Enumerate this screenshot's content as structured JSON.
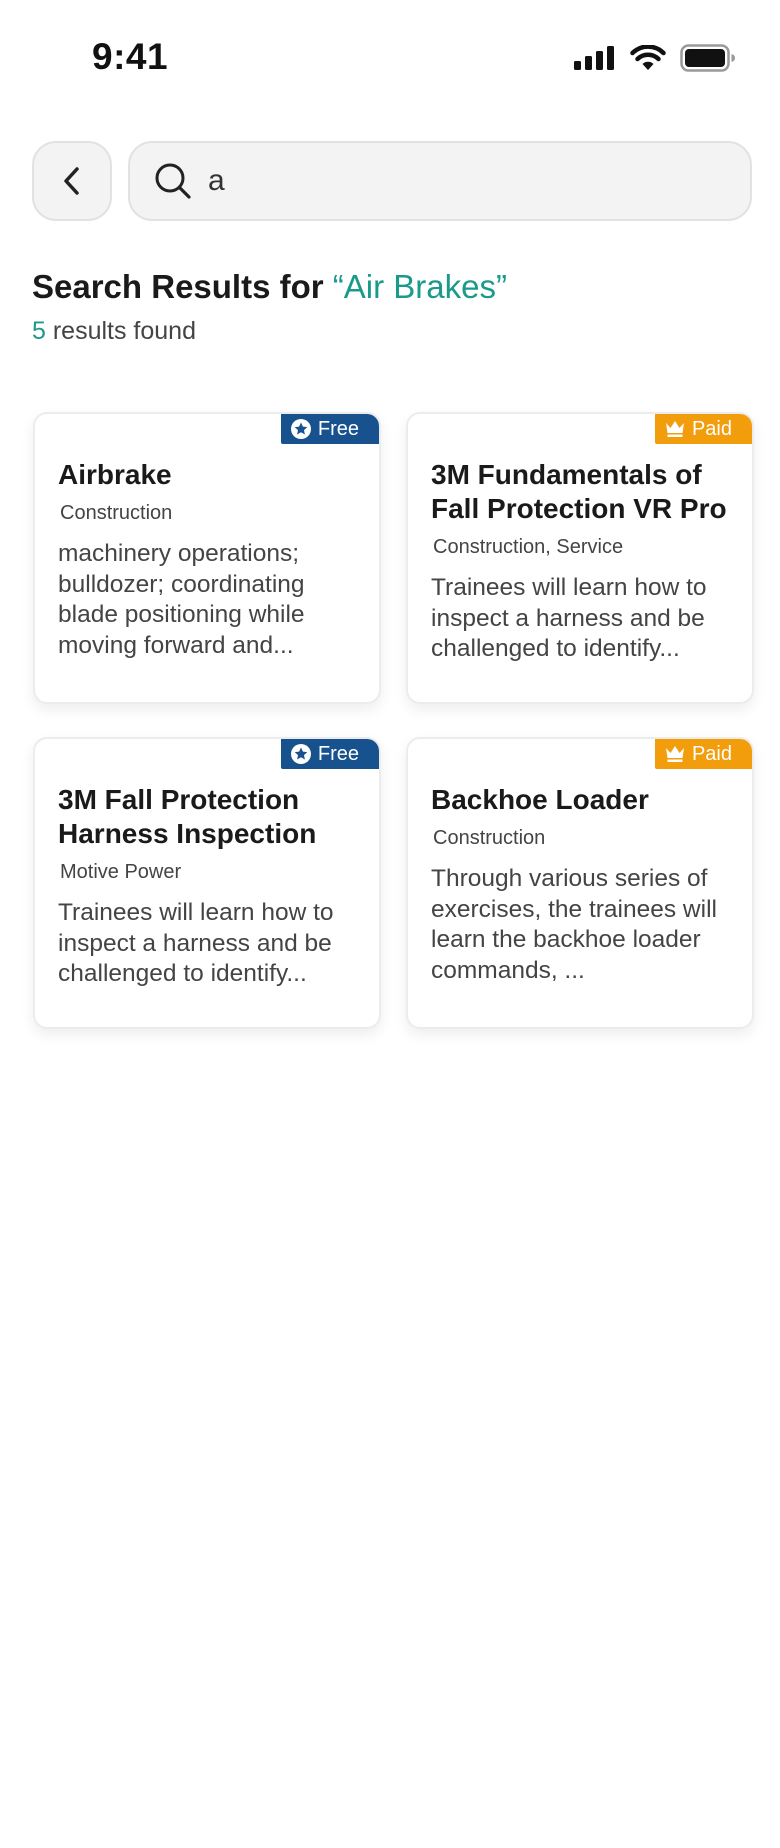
{
  "status_bar": {
    "time": "9:41"
  },
  "search": {
    "value": "a",
    "back_icon": "chevron-left-icon",
    "search_icon": "search-icon"
  },
  "results": {
    "title_prefix": "Search Results for ",
    "query": "“Air Brakes”",
    "count": "5",
    "count_suffix": " results found"
  },
  "cards": [
    {
      "badge": "Free",
      "badge_type": "free",
      "badge_color": "#17528f",
      "title": "Airbrake",
      "category": "Construction",
      "description": "machinery operations; bulldozer; coordinating blade positioning while moving forward and..."
    },
    {
      "badge": "Paid",
      "badge_type": "paid",
      "badge_color": "#f29d0c",
      "title": "3M Fundamentals of Fall Protection VR Pro",
      "category": "Construction, Service",
      "description": "Trainees will learn how to inspect a harness and be challenged to identify..."
    },
    {
      "badge": "Free",
      "badge_type": "free",
      "badge_color": "#17528f",
      "title": "3M Fall Protection Harness Inspection",
      "category": "Motive Power",
      "description": "Trainees will learn how to inspect a harness and be challenged to identify..."
    },
    {
      "badge": "Paid",
      "badge_type": "paid",
      "badge_color": "#f29d0c",
      "title": "Backhoe Loader",
      "category": "Construction",
      "description": "Through various series of exercises, the trainees will learn the backhoe loader commands, ..."
    }
  ],
  "colors": {
    "accent": "#1a9a8a",
    "free": "#17528f",
    "paid": "#f29d0c"
  }
}
